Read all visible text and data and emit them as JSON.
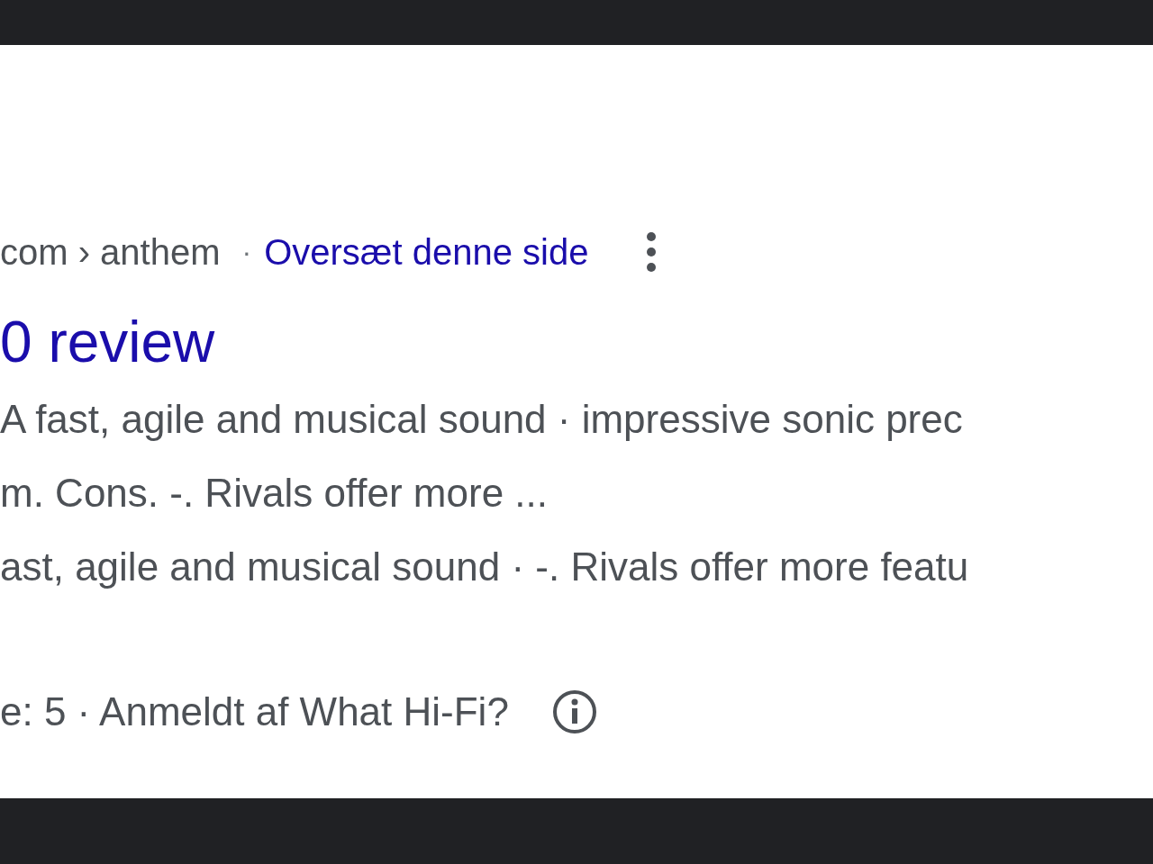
{
  "result": {
    "breadcrumb": "com › anthem",
    "separator": "·",
    "translate_link": "Oversæt denne side",
    "title": "0 review",
    "snippet_lines": [
      "A fast, agile and musical sound · impressive sonic prec",
      "m. Cons. -. Rivals offer more ...",
      "ast, agile and musical sound · -. Rivals offer more featu"
    ],
    "rating": "e: 5 · Anmeldt af What Hi-Fi?"
  }
}
